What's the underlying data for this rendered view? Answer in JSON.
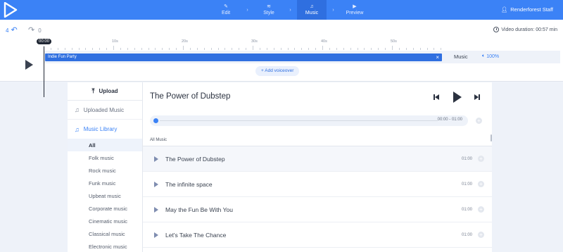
{
  "topbar": {
    "nav": [
      {
        "label": "Edit",
        "icon": "pencil-icon",
        "glyph": "✎"
      },
      {
        "label": "Style",
        "icon": "layers-icon",
        "glyph": "≋"
      },
      {
        "label": "Music",
        "icon": "music-note-icon",
        "glyph": "♫"
      },
      {
        "label": "Preview",
        "icon": "play-icon",
        "glyph": "▶"
      }
    ],
    "user": "Renderforest Staff",
    "accent": "#3b82f6"
  },
  "timeline": {
    "undo_count": "4",
    "redo_count": "0",
    "duration": "Video duration: 00:57 min",
    "current_time": "00:00",
    "ticks": [
      "10s",
      "20s",
      "30s",
      "40s",
      "50s"
    ],
    "track_name": "Indie Fun Party",
    "track_close": "×",
    "track_type": "Music",
    "volume": "100%",
    "add_voiceover": "+ Add voiceover"
  },
  "sidebar": {
    "upload": "Upload",
    "uploaded_music": "Uploaded Music",
    "music_library": "Music Library",
    "genres": [
      "All",
      "Folk music",
      "Rock music",
      "Funk music",
      "Upbeat music",
      "Corporate music",
      "Cinematic music",
      "Classical music",
      "Electronic music"
    ]
  },
  "player": {
    "title": "The Power of Dubstep",
    "progress_time": "00:00 - 01:00",
    "section_label": "All Music"
  },
  "songs": [
    {
      "name": "The Power of Dubstep",
      "duration": "01:00"
    },
    {
      "name": "The infinite space",
      "duration": "01:00"
    },
    {
      "name": "May the Fun Be With You",
      "duration": "01:00"
    },
    {
      "name": "Let's Take The Chance",
      "duration": "01:00"
    }
  ]
}
